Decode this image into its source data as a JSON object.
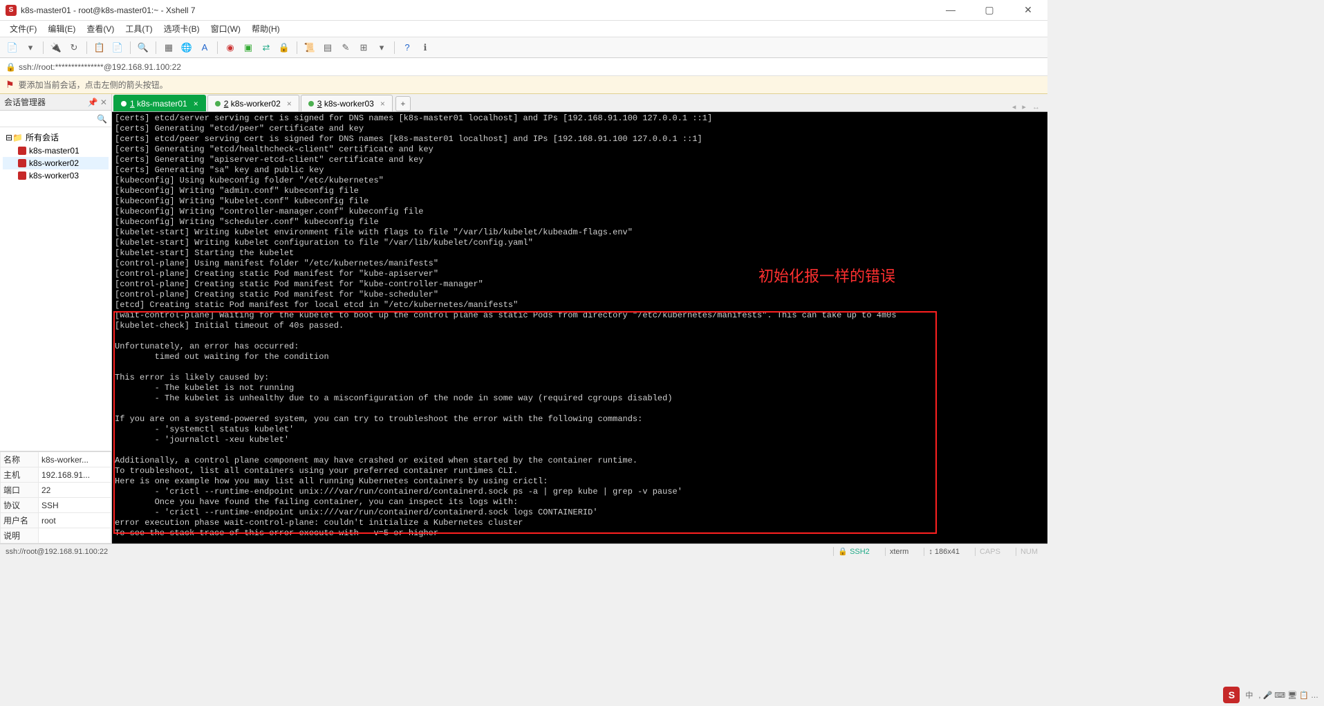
{
  "window": {
    "title": "k8s-master01 - root@k8s-master01:~ - Xshell 7"
  },
  "menu": {
    "file": "文件(F)",
    "edit": "编辑(E)",
    "view": "查看(V)",
    "tools": "工具(T)",
    "options": "选项卡(B)",
    "window": "窗口(W)",
    "help": "帮助(H)"
  },
  "addressbar": {
    "url": "ssh://root:***************@192.168.91.100:22"
  },
  "infobar": {
    "text": "要添加当前会话，点击左侧的箭头按钮。"
  },
  "sidebar": {
    "title": "会话管理器",
    "root": "所有会话",
    "sessions": [
      "k8s-master01",
      "k8s-worker02",
      "k8s-worker03"
    ]
  },
  "properties": {
    "rows": [
      {
        "k": "名称",
        "v": "k8s-worker..."
      },
      {
        "k": "主机",
        "v": "192.168.91..."
      },
      {
        "k": "端口",
        "v": "22"
      },
      {
        "k": "协议",
        "v": "SSH"
      },
      {
        "k": "用户名",
        "v": "root"
      },
      {
        "k": "说明",
        "v": ""
      }
    ]
  },
  "tabs": [
    {
      "num": "1",
      "label": "k8s-master01",
      "active": true
    },
    {
      "num": "2",
      "label": "k8s-worker02",
      "active": false
    },
    {
      "num": "3",
      "label": "k8s-worker03",
      "active": false
    }
  ],
  "annotation": "初始化报一样的错误",
  "terminal": "[certs] etcd/server serving cert is signed for DNS names [k8s-master01 localhost] and IPs [192.168.91.100 127.0.0.1 ::1]\n[certs] Generating \"etcd/peer\" certificate and key\n[certs] etcd/peer serving cert is signed for DNS names [k8s-master01 localhost] and IPs [192.168.91.100 127.0.0.1 ::1]\n[certs] Generating \"etcd/healthcheck-client\" certificate and key\n[certs] Generating \"apiserver-etcd-client\" certificate and key\n[certs] Generating \"sa\" key and public key\n[kubeconfig] Using kubeconfig folder \"/etc/kubernetes\"\n[kubeconfig] Writing \"admin.conf\" kubeconfig file\n[kubeconfig] Writing \"kubelet.conf\" kubeconfig file\n[kubeconfig] Writing \"controller-manager.conf\" kubeconfig file\n[kubeconfig] Writing \"scheduler.conf\" kubeconfig file\n[kubelet-start] Writing kubelet environment file with flags to file \"/var/lib/kubelet/kubeadm-flags.env\"\n[kubelet-start] Writing kubelet configuration to file \"/var/lib/kubelet/config.yaml\"\n[kubelet-start] Starting the kubelet\n[control-plane] Using manifest folder \"/etc/kubernetes/manifests\"\n[control-plane] Creating static Pod manifest for \"kube-apiserver\"\n[control-plane] Creating static Pod manifest for \"kube-controller-manager\"\n[control-plane] Creating static Pod manifest for \"kube-scheduler\"\n[etcd] Creating static Pod manifest for local etcd in \"/etc/kubernetes/manifests\"\n[wait-control-plane] Waiting for the kubelet to boot up the control plane as static Pods from directory \"/etc/kubernetes/manifests\". This can take up to 4m0s\n[kubelet-check] Initial timeout of 40s passed.\n\nUnfortunately, an error has occurred:\n        timed out waiting for the condition\n\nThis error is likely caused by:\n        - The kubelet is not running\n        - The kubelet is unhealthy due to a misconfiguration of the node in some way (required cgroups disabled)\n\nIf you are on a systemd-powered system, you can try to troubleshoot the error with the following commands:\n        - 'systemctl status kubelet'\n        - 'journalctl -xeu kubelet'\n\nAdditionally, a control plane component may have crashed or exited when started by the container runtime.\nTo troubleshoot, list all containers using your preferred container runtimes CLI.\nHere is one example how you may list all running Kubernetes containers by using crictl:\n        - 'crictl --runtime-endpoint unix:///var/run/containerd/containerd.sock ps -a | grep kube | grep -v pause'\n        Once you have found the failing container, you can inspect its logs with:\n        - 'crictl --runtime-endpoint unix:///var/run/containerd/containerd.sock logs CONTAINERID'\nerror execution phase wait-control-plane: couldn't initialize a Kubernetes cluster\nTo see the stack trace of this error execute with --v=5 or higher",
  "status": {
    "left": "ssh://root@192.168.91.100:22",
    "ssh": "SSH2",
    "term": "xterm",
    "size": "186x41",
    "caps": "CAPS",
    "num": "NUM"
  },
  "taskbar": {
    "time_hint": "中 , ● ⌨ 🖥 📋 ..."
  }
}
